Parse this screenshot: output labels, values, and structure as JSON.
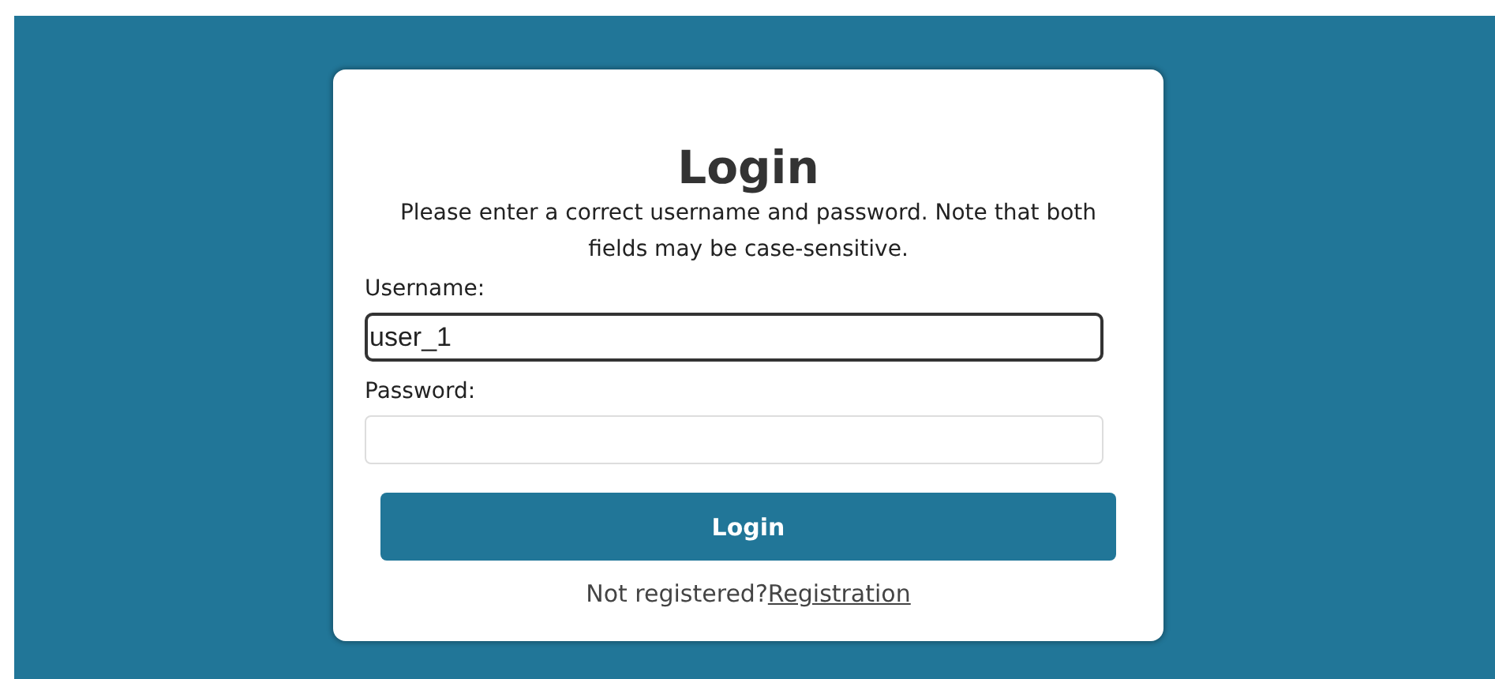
{
  "title": "Login",
  "instructions": "Please enter a correct username and password. Note that both fields may be case-sensitive.",
  "fields": [
    {
      "label": "Username:",
      "value": "user_1",
      "focused": true
    },
    {
      "label": "Password:",
      "focused": false
    }
  ],
  "submit": "Login",
  "footer": {
    "text": "Not registered?",
    "link": "Registration"
  }
}
